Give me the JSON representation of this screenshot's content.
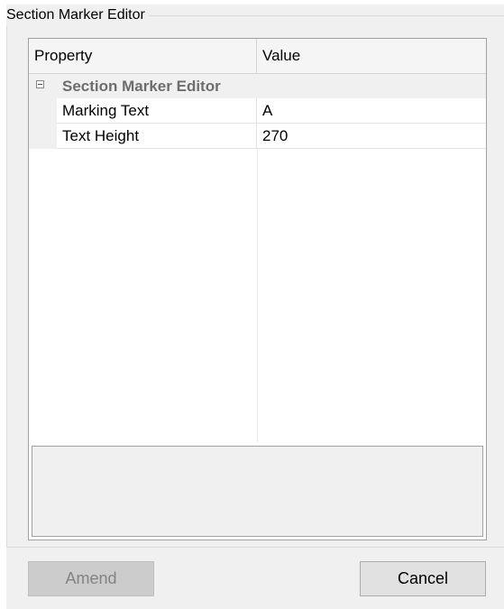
{
  "window": {
    "group_title": "Section Marker Editor"
  },
  "grid": {
    "columns": {
      "property": "Property",
      "value": "Value"
    },
    "category": {
      "label": "Section Marker Editor",
      "expanded": true,
      "expander_icon": "collapse-box-icon"
    },
    "rows": [
      {
        "name": "Marking Text",
        "value": "A"
      },
      {
        "name": "Text Height",
        "value": "270"
      }
    ]
  },
  "buttons": {
    "amend_label": "Amend",
    "amend_enabled": false,
    "cancel_label": "Cancel"
  }
}
